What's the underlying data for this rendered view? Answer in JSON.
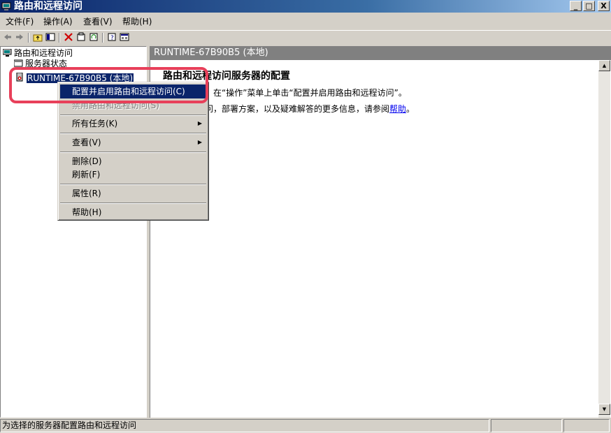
{
  "window": {
    "title": "路由和远程访问",
    "minimize": "_",
    "maximize": "□",
    "close": "X"
  },
  "menubar": {
    "file": "文件(F)",
    "action": "操作(A)",
    "view": "查看(V)",
    "help": "帮助(H)"
  },
  "toolbar": {
    "icons": [
      "back-icon",
      "forward-icon",
      "up-folder-icon",
      "show-hide-tree-icon",
      "delete-icon",
      "properties-icon",
      "refresh-icon",
      "help-icon",
      "console-icon"
    ]
  },
  "tree": {
    "root": "路由和远程访问",
    "server_status": "服务器状态",
    "server": "RUNTIME-67B90B5 (本地)"
  },
  "right": {
    "header": "RUNTIME-67B90B5 (本地)",
    "title": "路由和远程访问服务器的配置",
    "line1": "和远程访问，在“操作”菜单上单击“配置并启用路由和远程访问”。",
    "line2": "由和远程访问，部署方案，以及疑难解答的更多信息，请参阅",
    "help_link": "帮助",
    "line2_end": "。"
  },
  "context_menu": {
    "configure": "配置并启用路由和远程访问(C)",
    "disable": "禁用路由和远程访问(S)",
    "all_tasks": "所有任务(K)",
    "view": "查看(V)",
    "delete": "删除(D)",
    "refresh": "刷新(F)",
    "properties": "属性(R)",
    "help": "帮助(H)"
  },
  "statusbar": {
    "text": "为选择的服务器配置路由和远程访问"
  },
  "colors": {
    "selection": "#0a246a",
    "highlight_annotation": "#e8405a",
    "link": "#0000ee"
  }
}
